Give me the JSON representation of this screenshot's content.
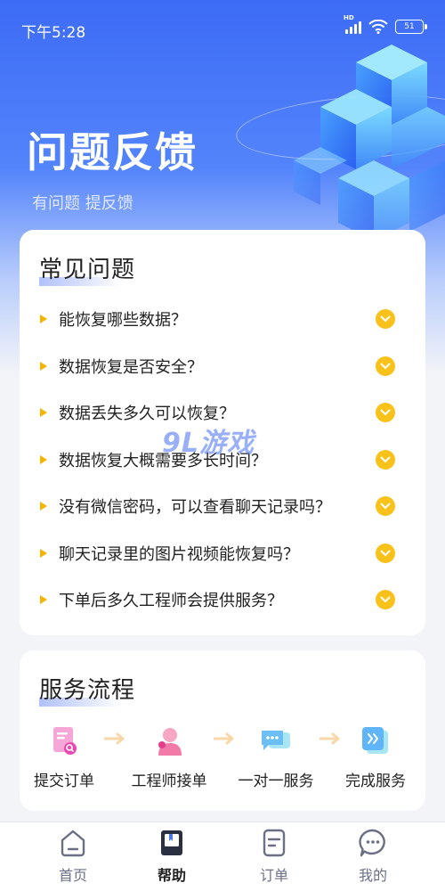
{
  "status_bar": {
    "time": "下午5:28",
    "network_badge": "HD",
    "battery_level": "51"
  },
  "header": {
    "title": "问题反馈",
    "subtitle": "有问题 提反馈"
  },
  "faq": {
    "title": "常见问题",
    "items": [
      "能恢复哪些数据？",
      "数据恢复是否安全？",
      "数据丢失多久可以恢复？",
      "数据恢复大概需要多长时间？",
      "没有微信密码，可以查看聊天记录吗？",
      "聊天记录里的图片视频能恢复吗？",
      "下单后多久工程师会提供服务？"
    ]
  },
  "service_flow": {
    "title": "服务流程",
    "steps": [
      {
        "label": "提交订单",
        "icon": "submit-order-icon"
      },
      {
        "label": "工程师接单",
        "icon": "engineer-icon"
      },
      {
        "label": "一对一服务",
        "icon": "chat-service-icon"
      },
      {
        "label": "完成服务",
        "icon": "complete-icon"
      }
    ]
  },
  "tabbar": {
    "items": [
      {
        "label": "首页",
        "icon": "home-icon"
      },
      {
        "label": "帮助",
        "icon": "help-book-icon"
      },
      {
        "label": "订单",
        "icon": "order-icon"
      },
      {
        "label": "我的",
        "icon": "message-icon"
      }
    ],
    "active": "帮助"
  },
  "watermark": "9L游戏",
  "colors": {
    "primary": "#3d6cf6",
    "accent": "#f8c21a",
    "bullet": "#f5b400",
    "text": "#222222",
    "tab_inactive": "#6b6f86"
  }
}
